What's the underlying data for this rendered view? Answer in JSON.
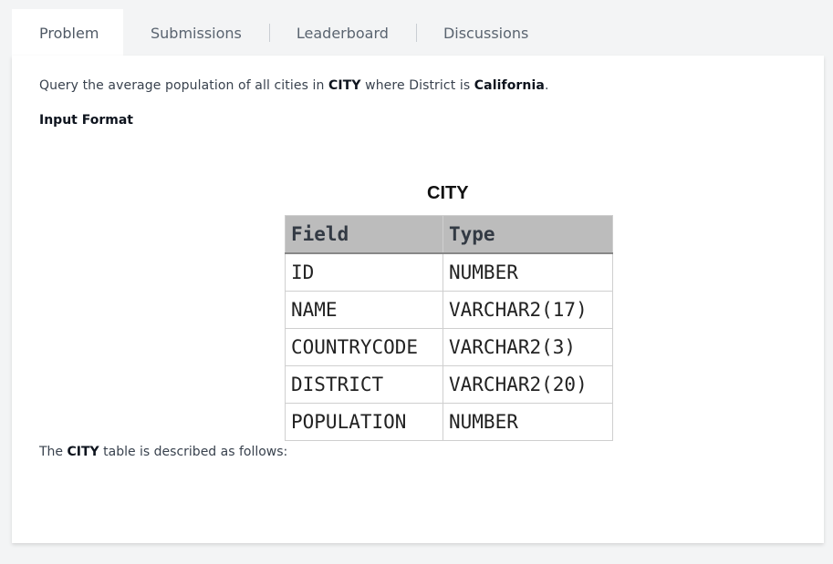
{
  "tabs": [
    {
      "label": "Problem",
      "active": true
    },
    {
      "label": "Submissions",
      "active": false
    },
    {
      "label": "Leaderboard",
      "active": false
    },
    {
      "label": "Discussions",
      "active": false
    }
  ],
  "problem": {
    "desc_pre": "Query the average population of all cities in ",
    "desc_city": "CITY",
    "desc_mid": " where District is ",
    "desc_district": "California",
    "desc_post": ".",
    "input_format_heading": "Input Format",
    "table_title": "CITY",
    "table_headers": [
      "Field",
      "Type"
    ],
    "table_rows": [
      [
        "ID",
        "NUMBER"
      ],
      [
        "NAME",
        "VARCHAR2(17)"
      ],
      [
        "COUNTRYCODE",
        "VARCHAR2(3)"
      ],
      [
        "DISTRICT",
        "VARCHAR2(20)"
      ],
      [
        "POPULATION",
        "NUMBER"
      ]
    ],
    "footer_pre": "The ",
    "footer_city": "CITY",
    "footer_post": " table is described as follows:"
  },
  "colors": {
    "page_bg": "#f3f4f5",
    "panel_bg": "#ffffff",
    "table_header_bg": "#bcbcbc"
  }
}
